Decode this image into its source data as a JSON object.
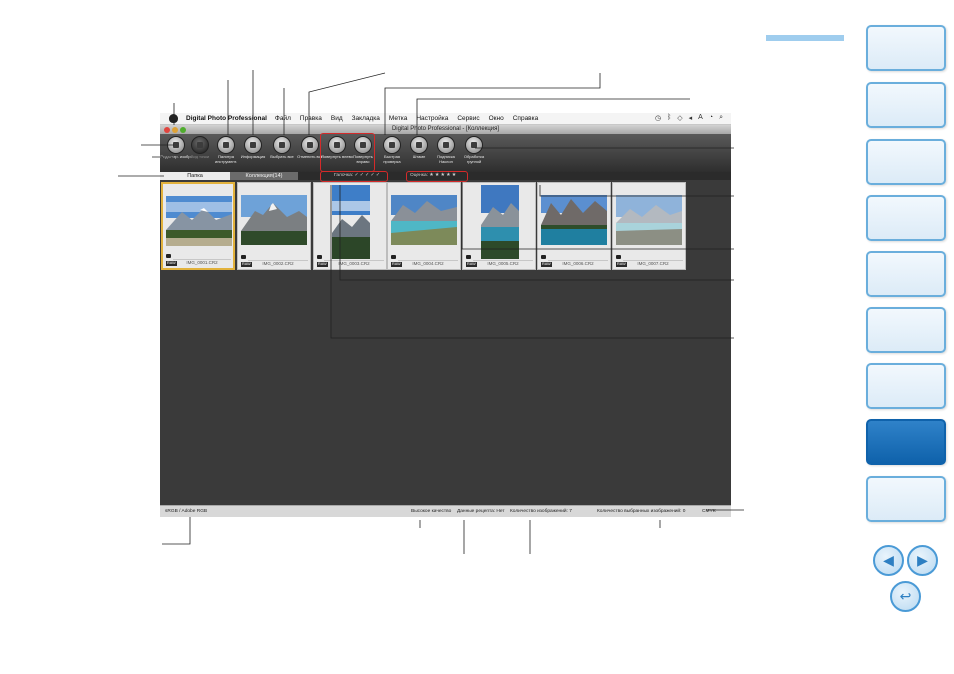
{
  "app": {
    "menubar": {
      "app_name": "Digital Photo Professional",
      "items": [
        "Файл",
        "Правка",
        "Вид",
        "Закладка",
        "Метка",
        "Настройка",
        "Сервис",
        "Окно",
        "Справка"
      ]
    },
    "window_title": "Digital Photo Professional - [Коллекция]",
    "toolbar": [
      {
        "label": "Редактир. изобр.",
        "icon": "edit-image-icon"
      },
      {
        "label": "Вид точки",
        "icon": "point-view-icon",
        "disabled": true
      },
      {
        "label": "Палитра инструмент.",
        "icon": "tool-palette-icon"
      },
      {
        "label": "Информация",
        "icon": "info-icon"
      },
      {
        "label": "Выбрать все",
        "icon": "select-all-icon"
      },
      {
        "label": "Отменить все",
        "icon": "deselect-all-icon"
      },
      {
        "label": "Повернуть влево",
        "icon": "rotate-left-icon"
      },
      {
        "label": "Повернуть вправо",
        "icon": "rotate-right-icon"
      },
      {
        "label": "Быстрая проверка",
        "icon": "quick-check-icon"
      },
      {
        "label": "Штамп",
        "icon": "stamp-icon"
      },
      {
        "label": "Подписка Наклон",
        "icon": "trim-angle-icon"
      },
      {
        "label": "Обработка группой",
        "icon": "batch-process-icon"
      }
    ],
    "tabs": {
      "folder": "Папка",
      "collection": "Коллекция(14)",
      "check_mark": "Галочка: ✓ ✓ ✓ ✓ ✓",
      "rating": "Оценка: ★ ★ ★ ★ ★"
    },
    "thumbnails": [
      {
        "name": "IMG_0001.CR2",
        "raw": "RAW",
        "selected": true
      },
      {
        "name": "IMG_0002.CR2",
        "raw": "RAW"
      },
      {
        "name": "IMG_0003.CR2",
        "raw": "RAW",
        "portrait": true
      },
      {
        "name": "IMG_0004.CR2",
        "raw": "RAW"
      },
      {
        "name": "IMG_0005.CR2",
        "raw": "RAW",
        "portrait": true
      },
      {
        "name": "IMG_0006.CR2",
        "raw": "RAW"
      },
      {
        "name": "IMG_0007.CR2",
        "raw": "RAW"
      }
    ],
    "statusbar": {
      "color_space": "sRGB / Adobe RGB",
      "quality": "Высокое качество",
      "recipe": "Данные рецепта: Нет",
      "image_count": "Количество изображений: 7",
      "selected_count": "Количество выбранных изображений: 0",
      "cms": "CMYK"
    }
  },
  "colors": {
    "nav_active": "#0f62ab",
    "nav_border": "#6aaedc",
    "callout_red": "#d42a2a",
    "window_bg": "#3a3a3a",
    "selection_border": "#e2b23c"
  }
}
